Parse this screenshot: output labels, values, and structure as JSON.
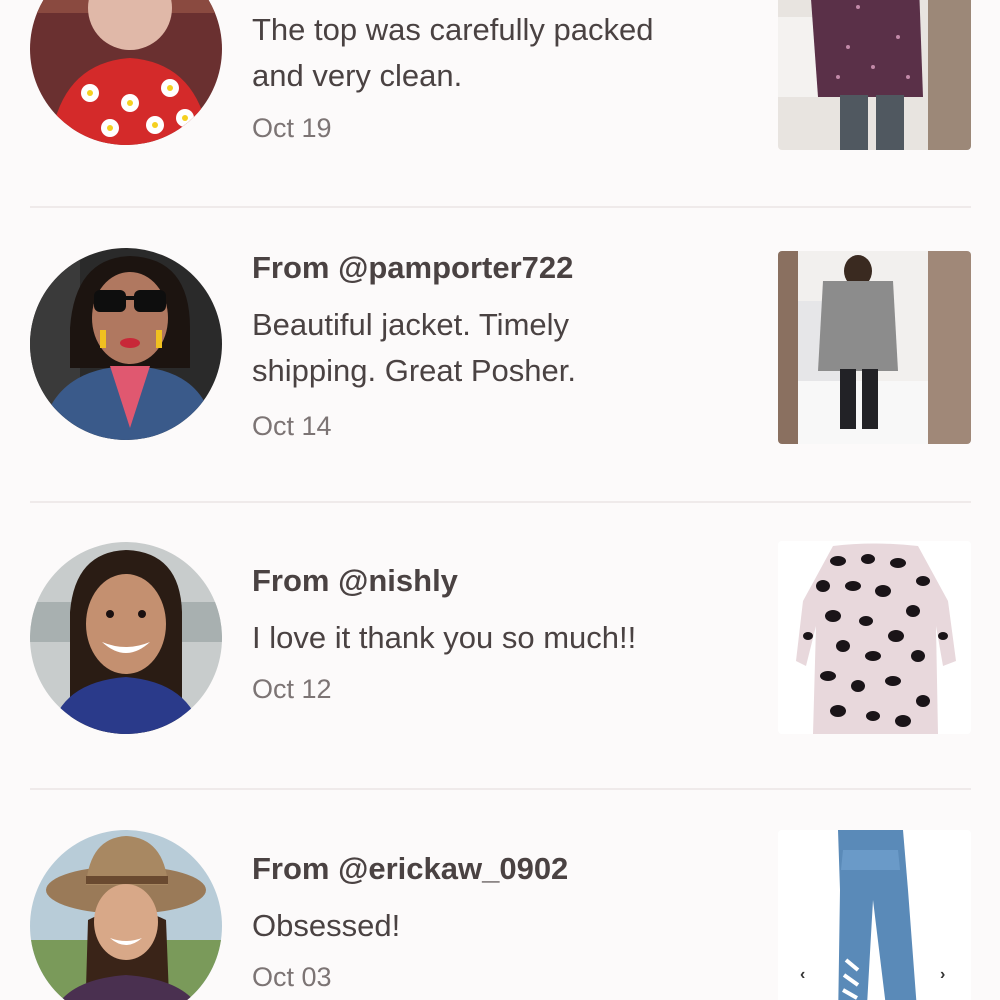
{
  "reviews": [
    {
      "from": "",
      "comment_lines": [
        "The top was carefully packed",
        "and very clean."
      ],
      "date": "Oct 19"
    },
    {
      "from": "From @pamporter722",
      "comment_lines": [
        "Beautiful jacket. Timely",
        "shipping. Great Posher."
      ],
      "date": "Oct 14"
    },
    {
      "from": "From @nishly",
      "comment_lines": [
        "I love it thank you so much!!"
      ],
      "date": "Oct 12"
    },
    {
      "from": "From @erickaw_0902",
      "comment_lines": [
        "Obsessed!"
      ],
      "date": "Oct 03"
    }
  ],
  "carousel": {
    "prev_glyph": "‹",
    "next_glyph": "›"
  },
  "colors": {
    "background": "#fcfafa",
    "text_primary": "#4a4242",
    "text_secondary": "#7c7474",
    "divider": "#efeaea"
  }
}
